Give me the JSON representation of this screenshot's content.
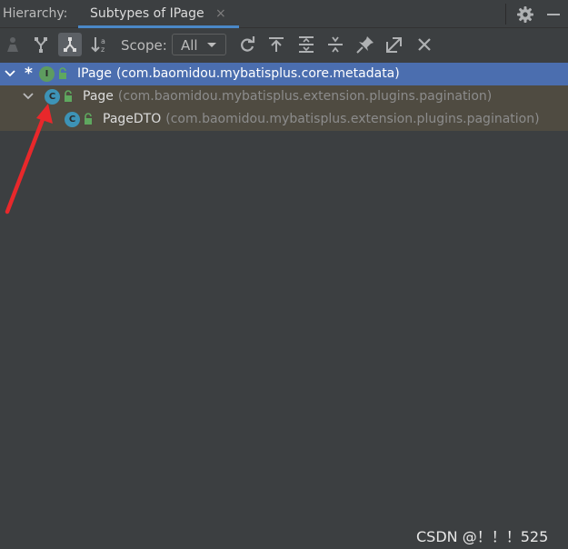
{
  "header": {
    "label": "Hierarchy:",
    "active_tab": "Subtypes of IPage",
    "close_glyph": "×"
  },
  "toolbar": {
    "scope_label": "Scope:",
    "scope_value": "All",
    "buttons": [
      "user-icon",
      "supertypes-icon",
      "subtypes-icon",
      "sort-alphabetically-icon",
      "refresh-icon",
      "export-icon",
      "expand-all-icon",
      "collapse-all-icon",
      "pin-icon",
      "open-external-icon",
      "close-icon"
    ]
  },
  "tree": {
    "rows": [
      {
        "marker": "*",
        "kind": "I",
        "name": "IPage",
        "package": "(com.baomidou.mybatisplus.core.metadata)"
      },
      {
        "kind": "C",
        "name": "Page",
        "package": "(com.baomidou.mybatisplus.extension.plugins.pagination)"
      },
      {
        "kind": "C",
        "name": "PageDTO",
        "package": "(com.baomidou.mybatisplus.extension.plugins.pagination)"
      }
    ]
  },
  "watermark": "CSDN @！！！525",
  "colors": {
    "background": "#3c3f41",
    "selected_row": "#4b6eaf",
    "highlight_row": "#4f4b41",
    "interface_icon": "#5e9c5f",
    "class_icon": "#3d93b6",
    "tab_underline": "#4a88c7",
    "annotation_arrow": "#e8282b"
  }
}
